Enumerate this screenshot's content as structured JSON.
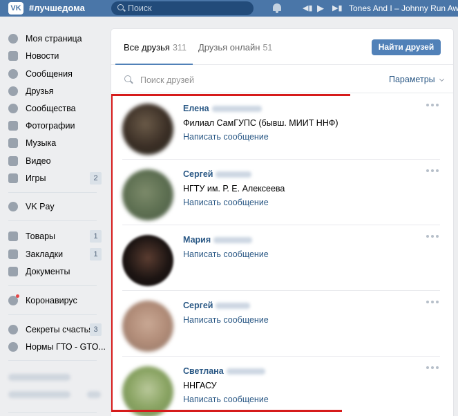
{
  "header": {
    "logo": "VK",
    "hashtag": "#лучшедома",
    "search_placeholder": "Поиск",
    "track": "Tones And I – Johnny Run Away"
  },
  "sidebar": {
    "items": [
      {
        "label": "Моя страница",
        "icon": "user-icon"
      },
      {
        "label": "Новости",
        "icon": "news-icon"
      },
      {
        "label": "Сообщения",
        "icon": "message-icon"
      },
      {
        "label": "Друзья",
        "icon": "friend-icon"
      },
      {
        "label": "Сообщества",
        "icon": "group-icon"
      },
      {
        "label": "Фотографии",
        "icon": "camera-icon"
      },
      {
        "label": "Музыка",
        "icon": "music-icon"
      },
      {
        "label": "Видео",
        "icon": "video-icon"
      },
      {
        "label": "Игры",
        "icon": "gamepad-icon",
        "count": "2"
      },
      {
        "label": "VK Pay",
        "icon": "vkpay-icon"
      },
      {
        "label": "Товары",
        "icon": "shopping-bag-icon",
        "count": "1"
      },
      {
        "label": "Закладки",
        "icon": "star-icon",
        "count": "1"
      },
      {
        "label": "Документы",
        "icon": "document-icon"
      },
      {
        "label": "Коронавирус",
        "icon": "virus-icon"
      },
      {
        "label": "Секреты счастья",
        "icon": "group-icon",
        "count": "3"
      },
      {
        "label": "Нормы ГТО - GTO...",
        "icon": "group-icon"
      }
    ]
  },
  "tabs": {
    "all_label": "Все друзья",
    "all_count": "311",
    "online_label": "Друзья онлайн",
    "online_count": "51",
    "find_button": "Найти друзей"
  },
  "friends_search": {
    "placeholder": "Поиск друзей",
    "params_label": "Параметры"
  },
  "friends": [
    {
      "name": "Елена",
      "subtitle": "Филиал СамГУПС (бывш. МИИТ ННФ)",
      "message": "Написать сообщение",
      "avatar_color": "#3a2e25"
    },
    {
      "name": "Сергей",
      "subtitle": "НГТУ им. Р. Е. Алексеева",
      "message": "Написать сообщение",
      "avatar_color": "#5e7052"
    },
    {
      "name": "Мария",
      "subtitle": "",
      "message": "Написать сообщение",
      "avatar_color": "#1d1513"
    },
    {
      "name": "Сергей",
      "subtitle": "",
      "message": "Написать сообщение",
      "avatar_color": "#b18c78"
    },
    {
      "name": "Светлана",
      "subtitle": "ННГАСУ",
      "message": "Написать сообщение",
      "avatar_color": "#8aa463"
    }
  ]
}
